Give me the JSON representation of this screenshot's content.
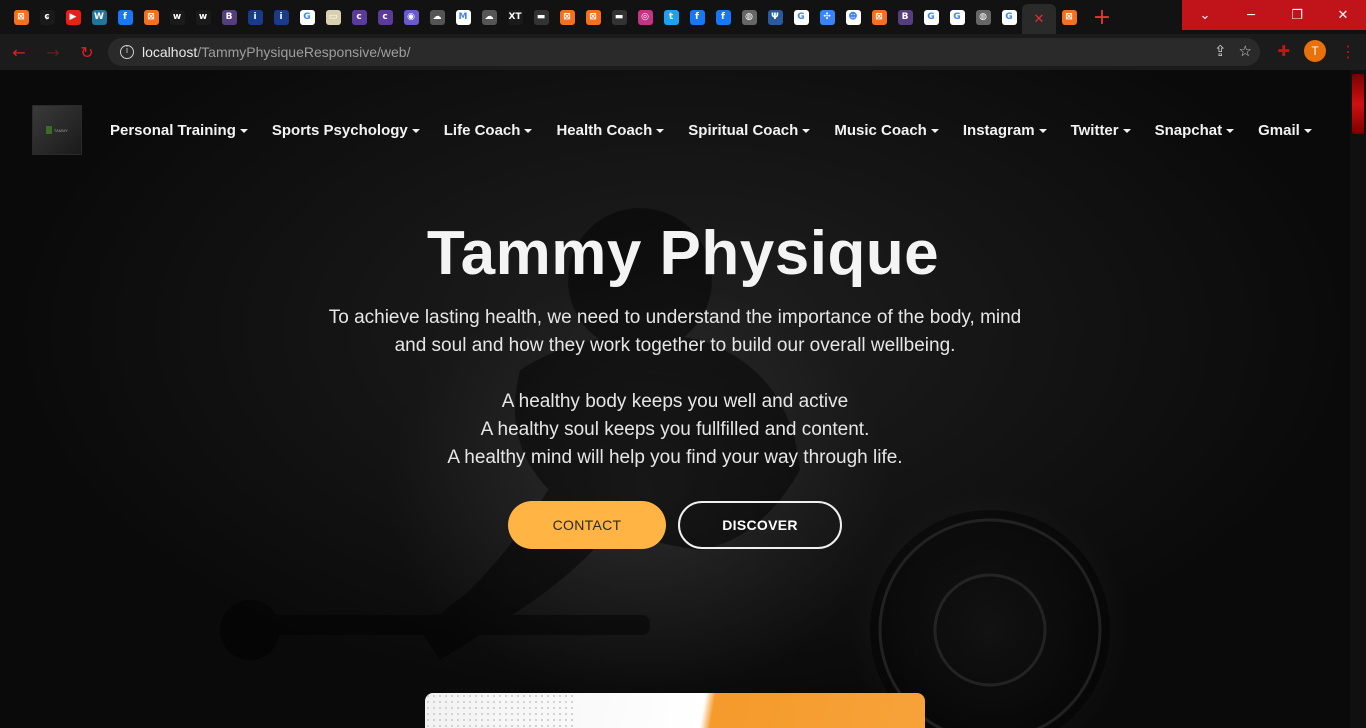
{
  "browser": {
    "tab_icons": [
      "xampp-icon",
      "leaf-icon",
      "youtube-icon",
      "wordpress-icon",
      "facebook-icon",
      "xampp-icon",
      "webflow-icon",
      "webflow-icon",
      "bootstrap-icon",
      "info-icon",
      "info-icon",
      "google-icon",
      "card-icon",
      "coolors-icon",
      "coolors-icon",
      "shield-icon",
      "cloud-icon",
      "gmail-icon",
      "cloud-icon",
      "xt-icon",
      "terminal-icon",
      "xampp-icon",
      "xampp-icon",
      "terminal-icon",
      "instagram-icon",
      "twitter-icon",
      "facebook-icon",
      "facebook-icon",
      "globe-icon",
      "psi-icon",
      "google-icon",
      "dots-icon",
      "snapchat-icon",
      "xampp-icon",
      "bootstrap-icon",
      "google-icon",
      "google-icon",
      "globe-icon",
      "google-icon"
    ],
    "active_tab_icon": "close-icon",
    "last_tab_icon": "xampp-icon",
    "url_host": "localhost",
    "url_path": "/TammyPhysiqueResponsive/web/",
    "profile_initial": "T",
    "accent": "#d32f2f"
  },
  "site": {
    "nav": [
      {
        "label": "Personal Training"
      },
      {
        "label": "Sports Psychology"
      },
      {
        "label": "Life Coach"
      },
      {
        "label": "Health Coach"
      },
      {
        "label": "Spiritual Coach"
      },
      {
        "label": "Music Coach"
      },
      {
        "label": "Instagram"
      },
      {
        "label": "Twitter"
      },
      {
        "label": "Snapchat"
      },
      {
        "label": "Gmail"
      }
    ],
    "hero": {
      "title": "Tammy Physique",
      "p1_line1": "To achieve lasting health, we need to understand the importance of the body, mind",
      "p1_line2": "and soul and how they work together to build our overall wellbeing.",
      "p2_line1": "A healthy body keeps you well and active",
      "p2_line2": "A healthy soul keeps you fullfilled and content.",
      "p2_line3": "A healthy mind will help you find your way through life."
    },
    "buttons": {
      "contact": "CONTACT",
      "discover": "DISCOVER"
    },
    "colors": {
      "button_accent": "#ffb444",
      "card_orange": "#f59a2b"
    }
  }
}
